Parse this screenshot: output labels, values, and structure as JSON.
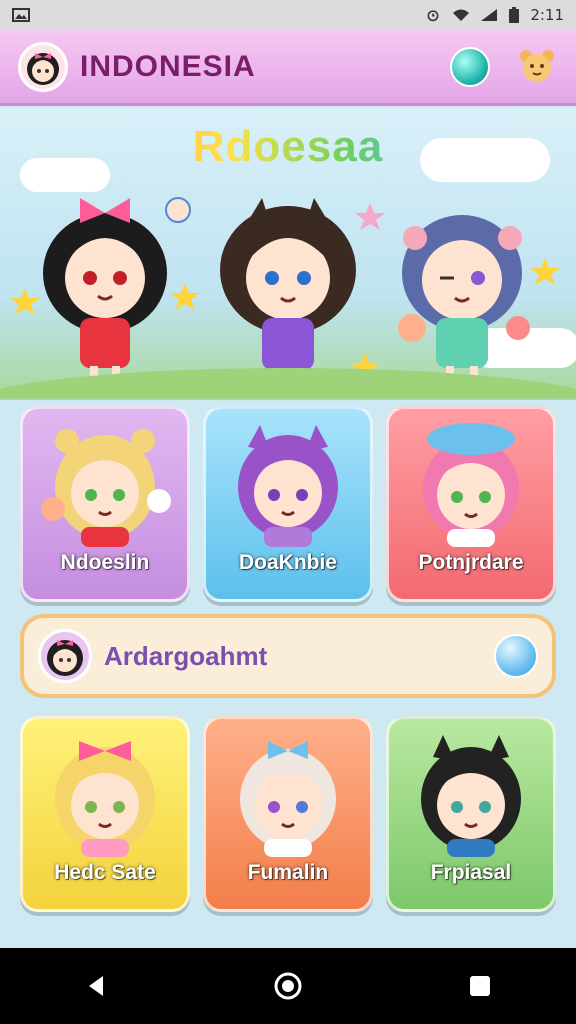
{
  "status": {
    "time": "2:11"
  },
  "header": {
    "title": "INDONESIA"
  },
  "hero": {
    "logo": "Rdoesaa"
  },
  "cards_top": [
    {
      "label": "Ndoeslin",
      "hair": "#f3d479",
      "eye": "#4fb54f",
      "color": "purple"
    },
    {
      "label": "DoaKnbie",
      "hair": "#9a52c8",
      "eye": "#7a3fb8",
      "color": "blue"
    },
    {
      "label": "Potnjrdare",
      "hair": "#f07ab0",
      "eye": "#4fb54f",
      "color": "red"
    }
  ],
  "banner": {
    "text": "Ardargoahmt"
  },
  "cards_bottom": [
    {
      "label": "Hedc Sate",
      "hair": "#f5d46a",
      "eye": "#7ab54f",
      "color": "yellow"
    },
    {
      "label": "Fumalin",
      "hair": "#eee6df",
      "eye": "#4f7ad8",
      "color": "orange"
    },
    {
      "label": "Frpiasal",
      "hair": "#222222",
      "eye": "#3fa8a0",
      "color": "green"
    }
  ],
  "icons": {
    "status": [
      "alarm-icon",
      "wifi-icon",
      "signal-icon",
      "battery-icon"
    ],
    "nav": [
      "back-icon",
      "home-icon",
      "recents-icon"
    ]
  }
}
